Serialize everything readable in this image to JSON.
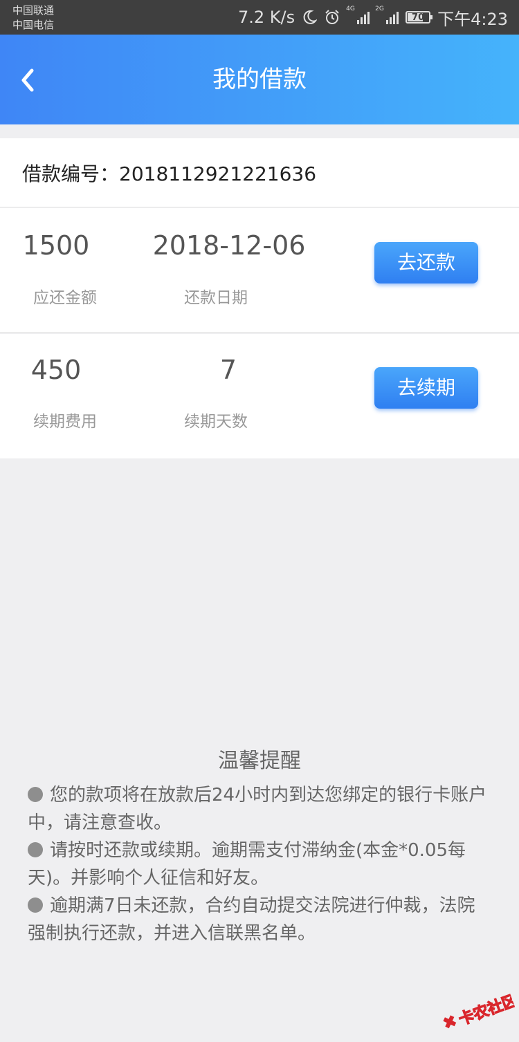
{
  "status_bar": {
    "carrier_1": "中国联通",
    "carrier_2": "中国电信",
    "net_speed": "7.2 K/s",
    "signal_1_label": "4G",
    "signal_2_label": "2G",
    "battery": "70",
    "time": "下午4:23",
    "icons": [
      "moon-icon",
      "alarm-icon",
      "signal-icon",
      "battery-icon"
    ]
  },
  "header": {
    "title": "我的借款",
    "back_icon": "chevron-left-icon"
  },
  "loan": {
    "number_label": "借款编号：",
    "number": "2018112921221636"
  },
  "repay": {
    "amount": "1500",
    "amount_label": "应还金额",
    "date": "2018-12-06",
    "date_label": "还款日期",
    "button": "去还款"
  },
  "renew": {
    "fee": "450",
    "fee_label": "续期费用",
    "days": "7",
    "days_label": "续期天数",
    "button": "去续期"
  },
  "reminder": {
    "title": "温馨提醒",
    "items": [
      "您的款项将在放款后24小时内到达您绑定的银行卡账户中，请注意查收。",
      "请按时还款或续期。逾期需支付滞纳金(本金*0.05每天)。并影响个人征信和好友。",
      "逾期满7日未还款，合约自动提交法院进行仲裁，法院强制执行还款，并进入信联黑名单。"
    ]
  },
  "watermark": {
    "text": "卡农社区"
  },
  "colors": {
    "header_start": "#3f86f6",
    "header_end": "#45b3fb",
    "button": "#2f7ff1",
    "background": "#efeff1"
  }
}
